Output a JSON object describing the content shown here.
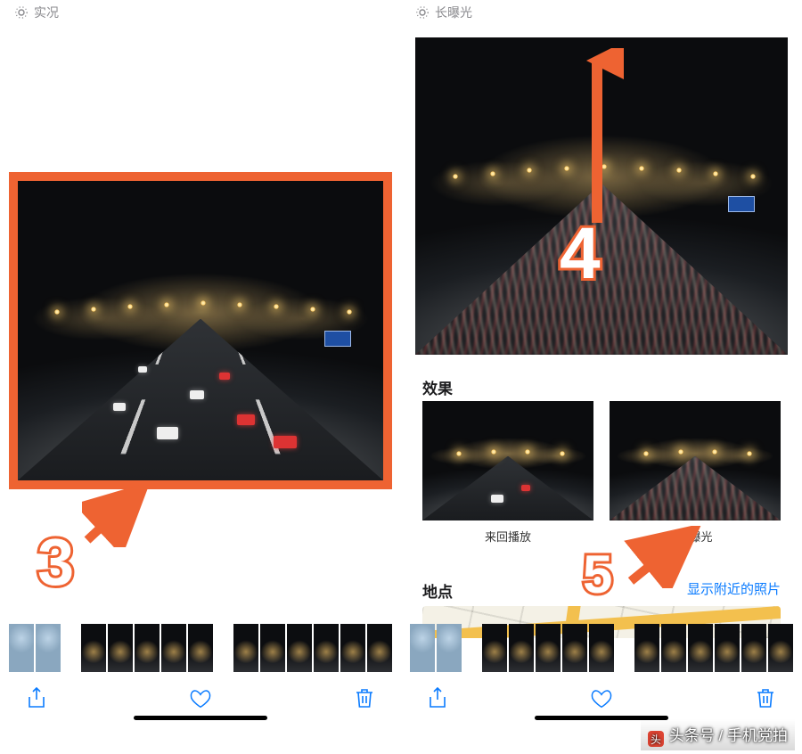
{
  "annotations": {
    "step3": "3",
    "step4": "4",
    "step5": "5"
  },
  "left": {
    "live_label": "实况"
  },
  "right": {
    "live_label": "长曝光",
    "effects_title": "效果",
    "effects": [
      {
        "label": "来回播放",
        "selected": false
      },
      {
        "label": "长曝光",
        "selected": true
      }
    ],
    "place_title": "地点",
    "show_nearby": "显示附近的照片"
  },
  "watermark": "头条号 / 手机党拍",
  "icons": {
    "live": "live-photo-icon",
    "share": "share-icon",
    "heart": "heart-icon",
    "trash": "trash-icon"
  }
}
